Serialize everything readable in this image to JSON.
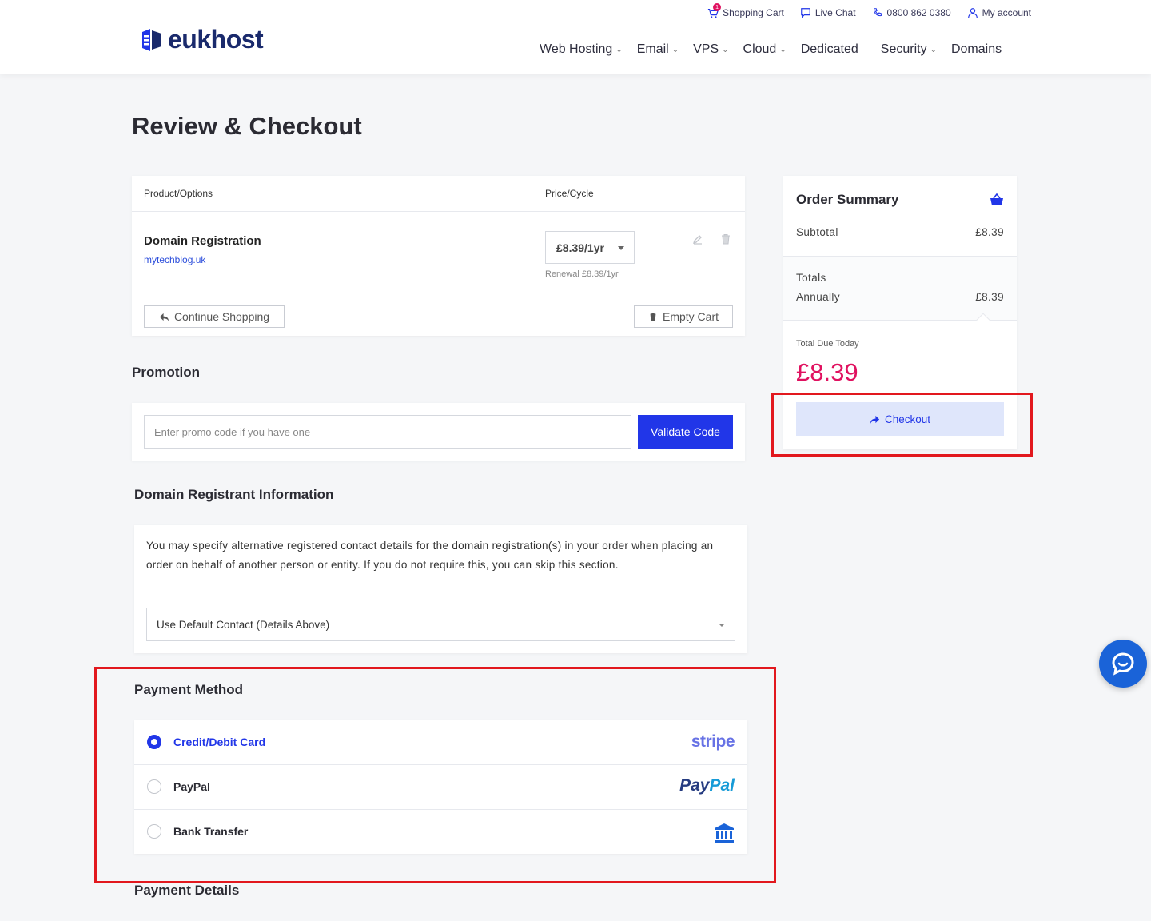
{
  "header": {
    "brand": "eukhost",
    "topbar": {
      "cart_count": "1",
      "cart_label": "Shopping Cart",
      "live_chat": "Live Chat",
      "phone": "0800 862 0380",
      "account": "My account"
    },
    "nav": [
      {
        "label": "Web Hosting",
        "has_dropdown": true
      },
      {
        "label": "Email",
        "has_dropdown": true
      },
      {
        "label": "VPS",
        "has_dropdown": true
      },
      {
        "label": "Cloud",
        "has_dropdown": true
      },
      {
        "label": "Dedicated",
        "has_dropdown": false
      },
      {
        "label": "Security",
        "has_dropdown": true
      },
      {
        "label": "Domains",
        "has_dropdown": false
      }
    ]
  },
  "page_title": "Review & Checkout",
  "cart": {
    "col_product": "Product/Options",
    "col_price": "Price/Cycle",
    "item": {
      "name": "Domain Registration",
      "domain": "mytechblog.uk",
      "price": "£8.39/1yr",
      "renewal": "Renewal £8.39/1yr"
    },
    "continue_label": "Continue Shopping",
    "empty_label": "Empty Cart"
  },
  "promotion": {
    "title": "Promotion",
    "placeholder": "Enter promo code if you have one",
    "button": "Validate Code"
  },
  "registrant": {
    "title": "Domain Registrant Information",
    "description": "You may specify alternative registered contact details for the domain registration(s) in your order when placing an order on behalf of another person or entity. If you do not require this, you can skip this section.",
    "selected": "Use Default Contact (Details Above)"
  },
  "payment": {
    "title": "Payment Method",
    "methods": [
      {
        "label": "Credit/Debit Card",
        "selected": true,
        "logo": "stripe"
      },
      {
        "label": "PayPal",
        "selected": false,
        "logo": "PayPal"
      },
      {
        "label": "Bank Transfer",
        "selected": false,
        "logo": "bank-icon"
      }
    ],
    "details_title": "Payment Details"
  },
  "summary": {
    "title": "Order Summary",
    "subtotal_label": "Subtotal",
    "subtotal_value": "£8.39",
    "totals_label": "Totals",
    "annually_label": "Annually",
    "annually_value": "£8.39",
    "due_label": "Total Due Today",
    "due_value": "£8.39",
    "checkout_label": "Checkout"
  },
  "colors": {
    "primary": "#2136e8",
    "accent_pink": "#e0115f",
    "highlight": "#e2181e",
    "brand_navy": "#1a2a6c"
  }
}
